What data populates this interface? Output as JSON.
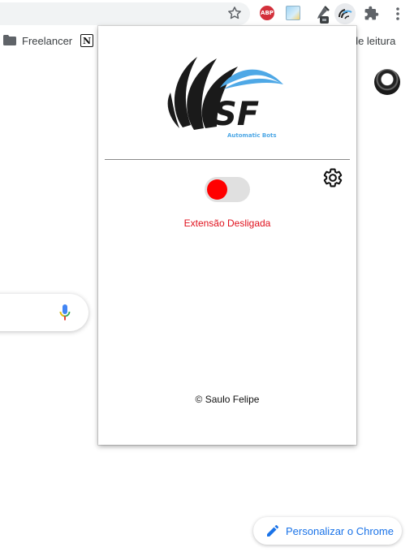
{
  "bookmarks": {
    "folder_label": "Freelancer",
    "notion_glyph": "N",
    "reading_list_label": "a de leitura"
  },
  "toolbar": {
    "abp_label": "ABP"
  },
  "popup": {
    "logo": {
      "initials": "SF",
      "tagline": "Automatic Bots",
      "accent_color": "#4ea8e6",
      "swoosh_color": "#1a1a1a"
    },
    "toggle": {
      "state": "off",
      "knob_color": "#ff0000"
    },
    "status_text": "Extensão Desligada",
    "status_color": "#e0101c",
    "footer_text": "© Saulo Felipe"
  },
  "page": {
    "customize_label": "Personalizar o Chrome",
    "accent_color": "#1a73e8"
  }
}
